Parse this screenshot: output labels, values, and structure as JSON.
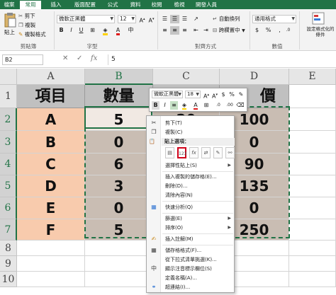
{
  "ribbon": {
    "tabs": [
      "檔案",
      "常用",
      "插入",
      "版面配置",
      "公式",
      "資料",
      "校閱",
      "檢視",
      "開發人員"
    ],
    "active_tab": "常用",
    "clipboard": {
      "cut": "剪下",
      "copy": "複製",
      "format_painter": "複製格式",
      "paste": "貼上",
      "label": "剪貼簿"
    },
    "font": {
      "name": "微軟正黑體",
      "size": "12",
      "label": "字型"
    },
    "alignment": {
      "wrap": "自動換列",
      "merge": "跨欄置中",
      "label": "對齊方式"
    },
    "number": {
      "format": "通用格式",
      "label": "數值"
    },
    "styles": {
      "conditional": "設定格式化的條件"
    }
  },
  "formula_bar": {
    "name_box": "B2",
    "value": "5"
  },
  "columns": [
    "A",
    "B",
    "C",
    "D",
    "E"
  ],
  "rows": [
    "1",
    "2",
    "3",
    "4",
    "5",
    "6",
    "7",
    "8",
    "9",
    "10"
  ],
  "table": {
    "headers": [
      "項目",
      "數量",
      "",
      "價"
    ],
    "items": [
      "A",
      "B",
      "C",
      "D",
      "E",
      "F"
    ],
    "qty": [
      "5",
      "0",
      "6",
      "3",
      "0",
      "5"
    ],
    "c_col": [
      "20",
      "",
      "",
      "",
      "",
      ""
    ],
    "price": [
      "100",
      "0",
      "90",
      "135",
      "0",
      "250"
    ]
  },
  "mini_toolbar": {
    "font": "微軟正黑體",
    "size": "18",
    "percent": "%"
  },
  "context_menu": {
    "cut": "剪下(T)",
    "copy": "複製(C)",
    "paste_options": "貼上選項：",
    "paste_special": "選擇性貼上(S)",
    "insert_copied": "插入複製的儲存格(E)...",
    "delete": "刪除(D)...",
    "clear": "清除內容(N)",
    "quick_analysis": "快速分析(Q)",
    "filter": "篩選(E)",
    "sort": "排序(O)",
    "insert_comment": "插入註解(M)",
    "format_cells": "儲存格格式(F)...",
    "pick_list": "從下拉式清單挑選(K)...",
    "phonetic": "顯示注音標示欄位(S)",
    "define_name": "定義名稱(A)...",
    "hyperlink": "超連結(I)..."
  }
}
